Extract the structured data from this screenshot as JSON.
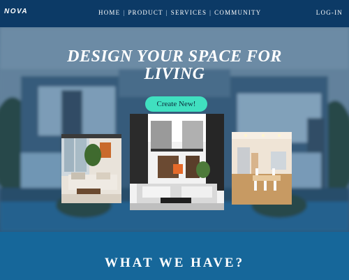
{
  "header": {
    "logo": "NOVA",
    "nav": [
      {
        "label": "HOME"
      },
      {
        "label": "PRODUCT"
      },
      {
        "label": "SERVICES"
      },
      {
        "label": "COMMUNITY"
      }
    ],
    "login": "LOG-IN"
  },
  "hero": {
    "headline_line1": "DESIGN YOUR SPACE FOR",
    "headline_line2": "LIVING",
    "cta": "Create New!"
  },
  "section": {
    "title": "WHAT WE HAVE?"
  },
  "colors": {
    "header_bg": "#0c3a66",
    "accent": "#40e0c0",
    "section_bg": "#16679a"
  }
}
